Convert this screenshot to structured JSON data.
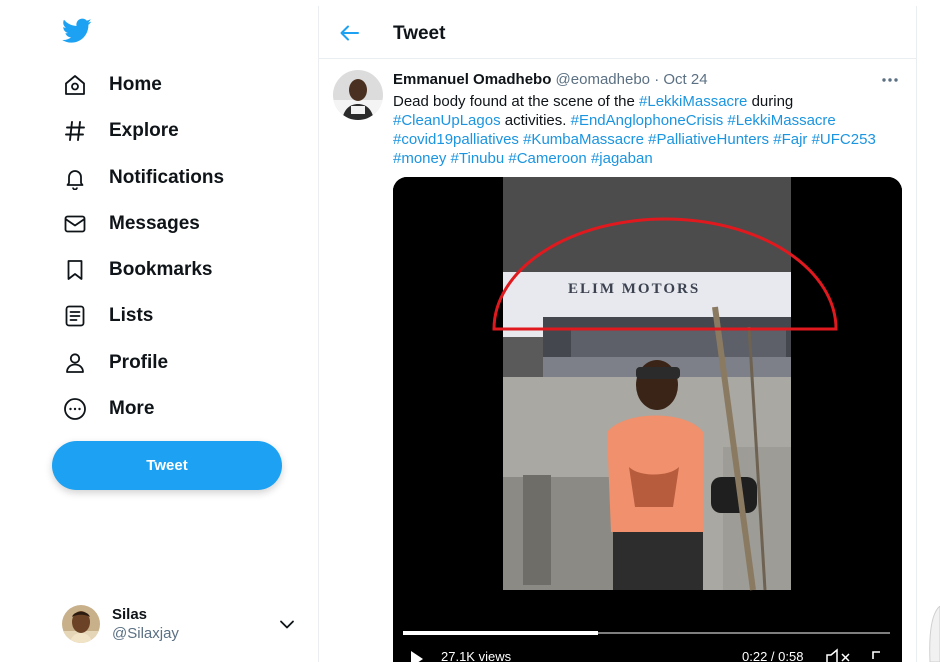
{
  "sidebar": {
    "logo": "twitter-bird-icon",
    "nav": [
      {
        "label": "Home",
        "icon": "home-icon"
      },
      {
        "label": "Explore",
        "icon": "hashtag-icon"
      },
      {
        "label": "Notifications",
        "icon": "bell-icon"
      },
      {
        "label": "Messages",
        "icon": "envelope-icon"
      },
      {
        "label": "Bookmarks",
        "icon": "bookmark-icon"
      },
      {
        "label": "Lists",
        "icon": "list-icon"
      },
      {
        "label": "Profile",
        "icon": "person-icon"
      },
      {
        "label": "More",
        "icon": "more-circle-icon"
      }
    ],
    "tweet_button": "Tweet",
    "account": {
      "name": "Silas",
      "handle": "@Silaxjay"
    }
  },
  "header": {
    "title": "Tweet"
  },
  "tweet": {
    "author": "Emmanuel Omadhebo",
    "handle": "@eomadhebo",
    "separator": "·",
    "date": "Oct 24",
    "text_parts": [
      {
        "t": "Dead body found at the scene of the ",
        "tag": false
      },
      {
        "t": "#LekkiMassacre",
        "tag": true
      },
      {
        "t": " during ",
        "tag": false
      },
      {
        "t": "#CleanUpLagos",
        "tag": true
      },
      {
        "t": " activities. ",
        "tag": false
      },
      {
        "t": "#EndAnglophoneCrisis",
        "tag": true
      },
      {
        "t": " ",
        "tag": false
      },
      {
        "t": "#LekkiMassacre",
        "tag": true
      },
      {
        "t": " ",
        "tag": false
      },
      {
        "t": "#covid19palliatives",
        "tag": true
      },
      {
        "t": " ",
        "tag": false
      },
      {
        "t": "#KumbaMassacre",
        "tag": true
      },
      {
        "t": " ",
        "tag": false
      },
      {
        "t": "#PalliativeHunters",
        "tag": true
      },
      {
        "t": " ",
        "tag": false
      },
      {
        "t": "#Fajr",
        "tag": true
      },
      {
        "t": " ",
        "tag": false
      },
      {
        "t": "#UFC253",
        "tag": true
      },
      {
        "t": " ",
        "tag": false
      },
      {
        "t": "#money",
        "tag": true
      },
      {
        "t": " ",
        "tag": false
      },
      {
        "t": "#Tinubu",
        "tag": true
      },
      {
        "t": " ",
        "tag": false
      },
      {
        "t": "#Cameroon",
        "tag": true
      },
      {
        "t": " ",
        "tag": false
      },
      {
        "t": "#jagaban",
        "tag": true
      }
    ],
    "video": {
      "sign_text": "ELIM MOTORS",
      "views": "27.1K views",
      "time": "0:22 / 0:58",
      "progress": 0.4
    }
  },
  "colors": {
    "accent": "#1da1f2",
    "link": "#1b95e0",
    "annotation": "#e0191f"
  }
}
